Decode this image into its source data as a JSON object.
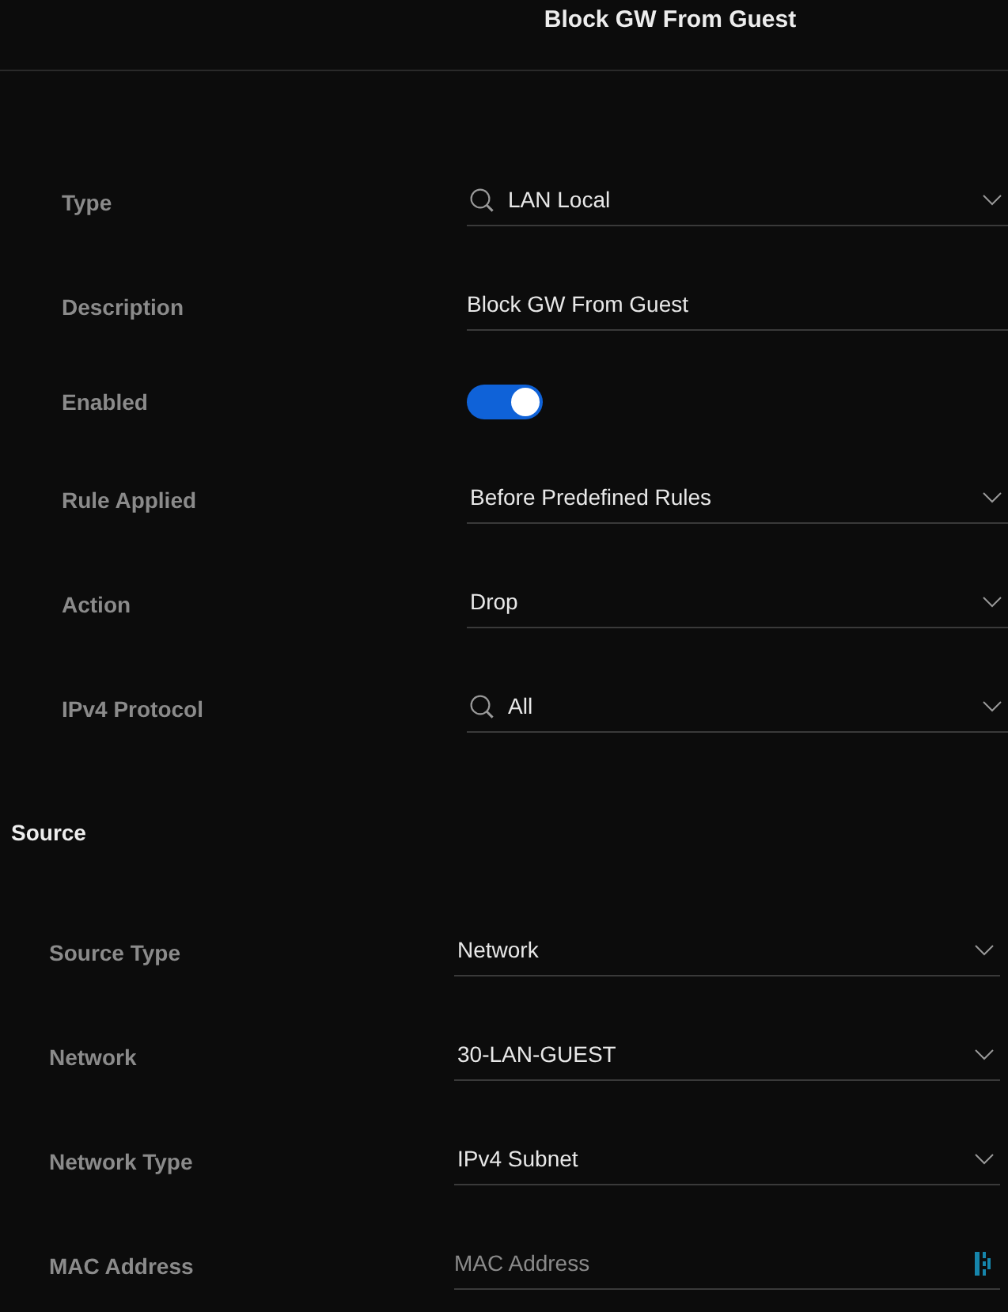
{
  "header": {
    "title": "Block GW From Guest"
  },
  "rule_fields": [
    {
      "kind": "select",
      "label": "Type",
      "value": "LAN Local",
      "searchable": true
    },
    {
      "kind": "text",
      "label": "Description",
      "value": "Block GW From Guest"
    },
    {
      "kind": "toggle",
      "label": "Enabled",
      "on": true
    },
    {
      "kind": "select",
      "label": "Rule Applied",
      "value": "Before Predefined Rules",
      "searchable": false
    },
    {
      "kind": "select",
      "label": "Action",
      "value": "Drop",
      "searchable": false
    },
    {
      "kind": "select",
      "label": "IPv4 Protocol",
      "value": "All",
      "searchable": true
    }
  ],
  "source": {
    "heading": "Source",
    "fields": [
      {
        "kind": "select",
        "label": "Source Type",
        "value": "Network",
        "searchable": false
      },
      {
        "kind": "select",
        "label": "Network",
        "value": "30-LAN-GUEST",
        "searchable": false
      },
      {
        "kind": "select",
        "label": "Network Type",
        "value": "IPv4 Subnet",
        "searchable": false
      },
      {
        "kind": "text",
        "label": "MAC Address",
        "placeholder": "MAC Address",
        "picker": true
      }
    ]
  }
}
